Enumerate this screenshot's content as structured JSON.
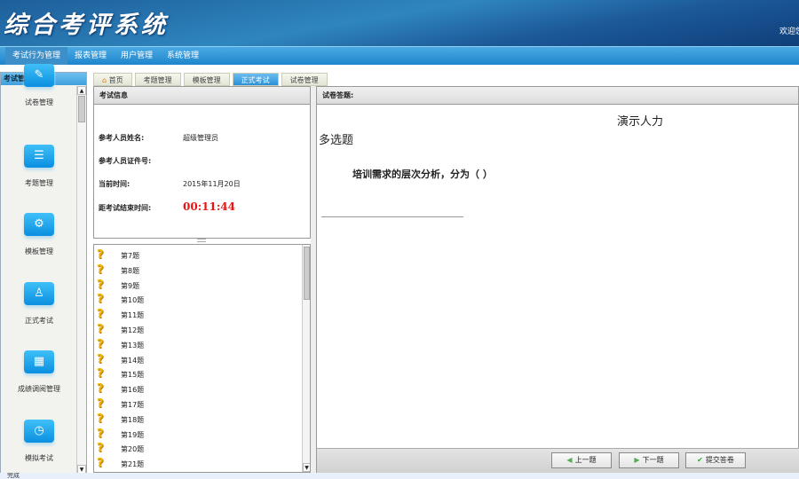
{
  "header": {
    "title": "综合考评系统",
    "welcome": "欢迎您"
  },
  "nav": [
    "考试行为管理",
    "报表管理",
    "用户管理",
    "系统管理"
  ],
  "sidebar": {
    "title": "考试管理",
    "items": [
      {
        "label": "试卷管理",
        "icon": "paper-icon",
        "glyph": "✎"
      },
      {
        "label": "考题管理",
        "icon": "list-icon",
        "glyph": "☰"
      },
      {
        "label": "模板管理",
        "icon": "template-gear-icon",
        "glyph": "⚙"
      },
      {
        "label": "正式考试",
        "icon": "exam-user-icon",
        "glyph": "♙"
      },
      {
        "label": "成绩调阅管理",
        "icon": "score-chart-icon",
        "glyph": "▦"
      },
      {
        "label": "模拟考试",
        "icon": "mock-exam-clock-icon",
        "glyph": "◷"
      }
    ]
  },
  "tabs": [
    "首页",
    "考题管理",
    "模板管理",
    "正式考试",
    "试卷管理"
  ],
  "info": {
    "title": "考试信息",
    "name_label": "参考人员姓名:",
    "name": "超级管理员",
    "id_label": "参考人员证件号:",
    "time_label": "当前时间:",
    "time": "2015年11月20日",
    "remain_label": "距考试结束时间:",
    "remain": "00:11:44"
  },
  "questions": [
    "第7题",
    "第8题",
    "第9题",
    "第10题",
    "第11题",
    "第12题",
    "第13题",
    "第14题",
    "第15题",
    "第16题",
    "第17题",
    "第18题",
    "第19题",
    "第20题",
    "第21题"
  ],
  "answer": {
    "header": "试卷答题:",
    "paper_title": "演示人力",
    "type": "多选题",
    "question": "培训需求的层次分析，分为（   ）"
  },
  "buttons": {
    "prev": "上一题",
    "next": "下一题",
    "submit": "提交答卷"
  },
  "status": "完成"
}
